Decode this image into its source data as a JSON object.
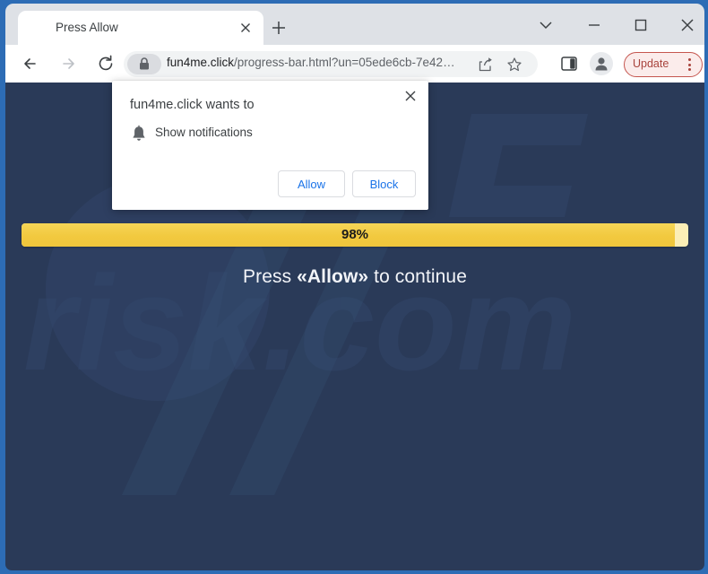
{
  "browser": {
    "tab": {
      "title": "Press Allow",
      "close_icon": "close-icon",
      "new_tab_icon": "plus-icon"
    },
    "window_controls": {
      "tab_search_icon": "chevron-down-icon",
      "minimize_icon": "minimize-icon",
      "maximize_icon": "maximize-icon",
      "close_icon": "close-icon"
    },
    "toolbar": {
      "back_icon": "arrow-left-icon",
      "forward_icon": "arrow-right-icon",
      "reload_icon": "reload-icon",
      "lock_icon": "lock-icon",
      "url_domain": "fun4me.click",
      "url_path": "/progress-bar.html?un=05ede6cb-7e42…",
      "url_full": "fun4me.click/progress-bar.html?un=05ede6cb-7e42…",
      "share_icon": "share-icon",
      "bookmark_icon": "star-icon",
      "side_panel_icon": "side-panel-icon",
      "profile_icon": "avatar-person-icon",
      "update_label": "Update",
      "menu_icon": "three-dot-menu-icon"
    }
  },
  "dialog": {
    "title": "fun4me.click wants to",
    "permission_icon": "bell-icon",
    "permission_text": "Show notifications",
    "allow_label": "Allow",
    "block_label": "Block",
    "close_icon": "close-icon"
  },
  "page": {
    "progress_percent": 98,
    "progress_label": "98%",
    "headline_prefix": "Press ",
    "headline_emphasis": "«Allow»",
    "headline_suffix": " to continue",
    "watermark_text": "pcrisk.com",
    "colors": {
      "page_background": "#2a3a58",
      "progress_fill": "#f2c93f",
      "progress_track": "#fbeeb6",
      "window_frame": "#2d6cb5",
      "link_blue": "#1a73e8",
      "update_accent": "#c5564f"
    }
  }
}
